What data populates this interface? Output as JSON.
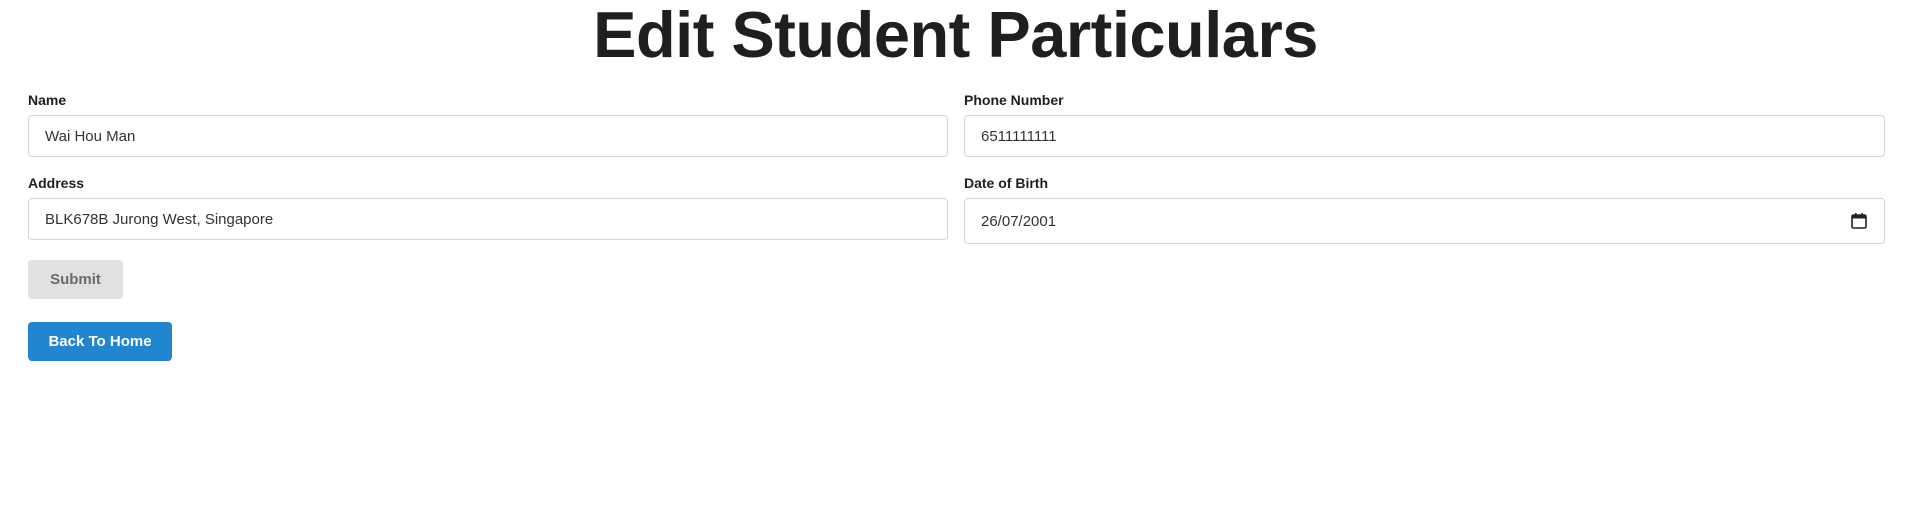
{
  "page": {
    "title": "Edit Student Particulars"
  },
  "form": {
    "name": {
      "label": "Name",
      "value": "Wai Hou Man"
    },
    "phone": {
      "label": "Phone Number",
      "value": "6511111111"
    },
    "address": {
      "label": "Address",
      "value": "BLK678B Jurong West, Singapore"
    },
    "dob": {
      "label": "Date of Birth",
      "value": "26/07/2001",
      "icon": "calendar-icon"
    }
  },
  "buttons": {
    "submit_label": "Submit",
    "back_home_label": "Back To Home"
  },
  "colors": {
    "primary": "#2185d0",
    "disabled_bg": "#e0e1e2",
    "disabled_text": "#6b6b6b"
  }
}
